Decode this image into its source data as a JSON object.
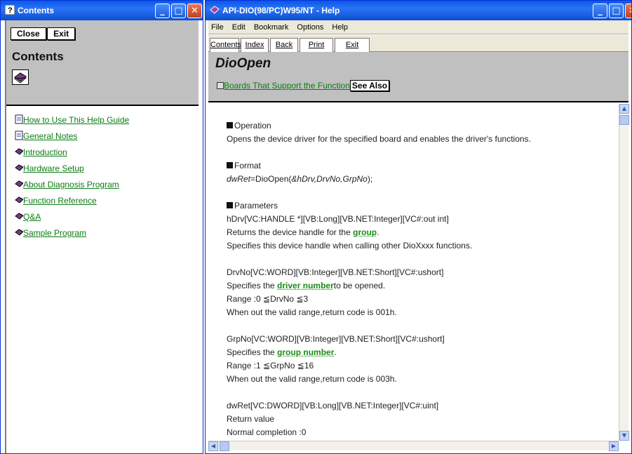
{
  "left_window": {
    "title": "Contents",
    "buttons": {
      "close": "Close",
      "exit": "Exit"
    },
    "heading": "Contents",
    "items": [
      {
        "label": "How to Use This Help Guide",
        "icon": "page-icon"
      },
      {
        "label": "General Notes",
        "icon": "page-icon"
      },
      {
        "label": "Introduction",
        "icon": "book-icon"
      },
      {
        "label": "Hardware Setup",
        "icon": "book-icon"
      },
      {
        "label": "About Diagnosis Program",
        "icon": "book-icon"
      },
      {
        "label": "Function Reference",
        "icon": "book-icon"
      },
      {
        "label": "Q&A",
        "icon": "book-icon"
      },
      {
        "label": "Sample Program",
        "icon": "book-icon"
      }
    ]
  },
  "right_window": {
    "title": "API-DIO(98/PC)W95/NT - Help",
    "menu": [
      "File",
      "Edit",
      "Bookmark",
      "Options",
      "Help"
    ],
    "tabs": [
      "Contents",
      "Index",
      "Back",
      "Print",
      "Exit"
    ],
    "topic_title": "DioOpen",
    "boards_link": "Boards That Support the Function",
    "see_also": "See Also",
    "content": {
      "operation_heading": "Operation",
      "operation_text": "Opens the device driver for the specified board and enables the driver's functions.",
      "format_heading": "Format",
      "format_ret": "dwRet",
      "format_eq": "=DioOpen(",
      "format_args": "&hDrv,DrvNo,GrpNo",
      "format_end": ");",
      "parameters_heading": "Parameters",
      "hdrv_sig": "hDrv[VC:HANDLE *][VB:Long][VB.NET:Integer][VC#:out int]",
      "hdrv_line1_pre": "Returns the device handle for the ",
      "hdrv_line1_link": "group",
      "hdrv_line1_post": ".",
      "hdrv_line2": " Specifies this device handle when calling other DioXxxx functions.",
      "drvno_sig": "DrvNo[VC:WORD][VB:Integer][VB.NET:Short][VC#:ushort]",
      "drvno_line1_pre": "Specifies the ",
      "drvno_line1_link": "driver number",
      "drvno_line1_post": "to be opened.",
      "drvno_range": "Range :0 ≦DrvNo ≦3",
      "drvno_err": "When out the valid range,return code is 001h.",
      "grpno_sig": "GrpNo[VC:WORD][VB:Integer][VB.NET:Short][VC#:ushort]",
      "grpno_line1_pre": "Specifies the ",
      "grpno_line1_link": "group number",
      "grpno_line1_post": ".",
      "grpno_range": "Range :1 ≦GrpNo ≦16",
      "grpno_err": "When out the valid range,return code is 003h.",
      "dwret_sig": "dwRet[VC:DWORD][VB:Long][VB.NET:Integer][VC#:uint]",
      "dwret_line1": "Return value",
      "dwret_line2": "Normal completion   :0"
    }
  }
}
